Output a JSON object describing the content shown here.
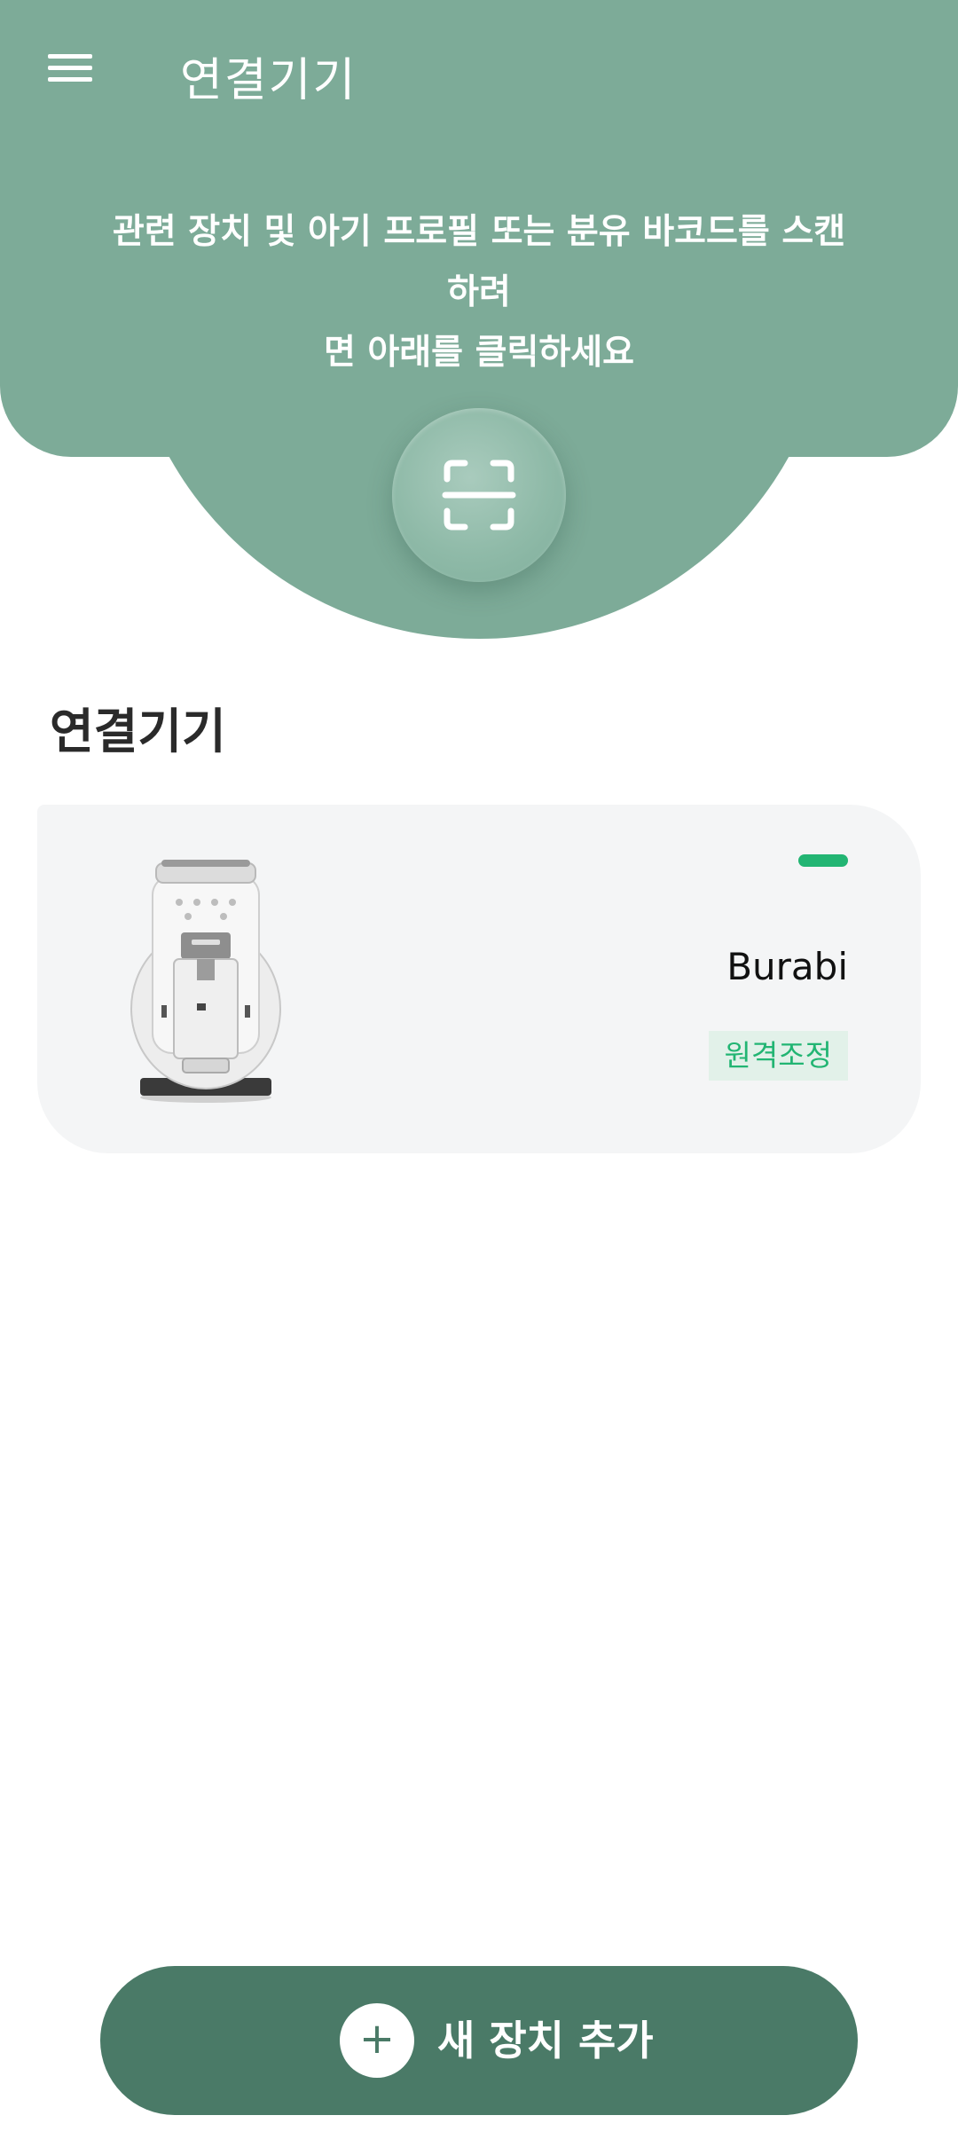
{
  "header": {
    "title": "연결기기",
    "menu_icon": "hamburger-menu-icon",
    "instruction_line1": "관련 장치 및 아기 프로필 또는 분유 바코드를 스캔하려",
    "instruction_line2": "면 아래를 클릭하세요",
    "scan_icon": "scan-frame-icon",
    "background_color": "#7dab98"
  },
  "main": {
    "section_title": "연결기기",
    "devices": [
      {
        "name": "Burabi",
        "image": "formula-maker-machine",
        "status_color": "#22b573",
        "action_label": "원격조정"
      }
    ]
  },
  "footer": {
    "add_button_label": "새 장치 추가",
    "add_icon": "plus-icon",
    "add_icon_glyph": "+",
    "button_color": "#4a7a67"
  }
}
